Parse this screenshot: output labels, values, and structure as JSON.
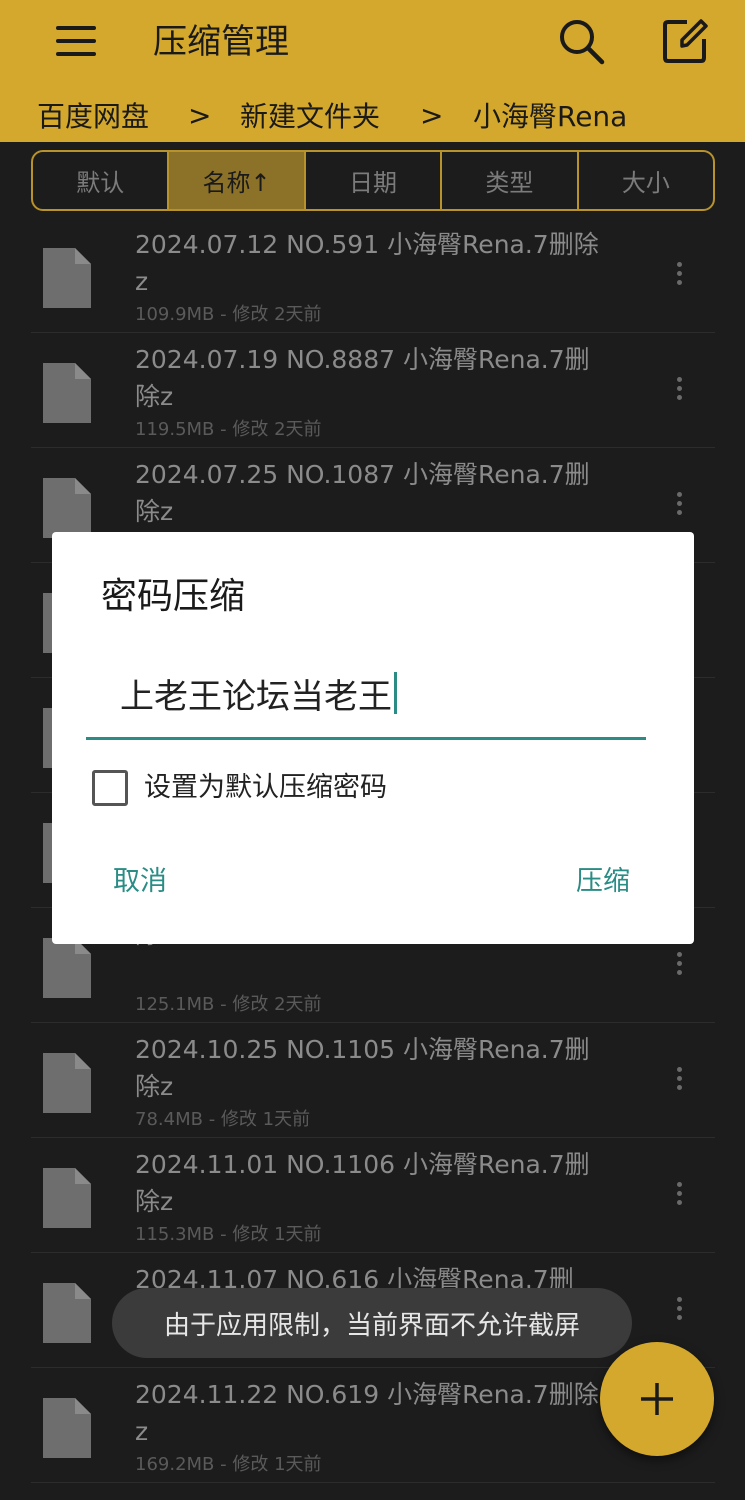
{
  "header": {
    "title": "压缩管理",
    "breadcrumb": [
      "百度网盘",
      "新建文件夹",
      "小海臀Rena"
    ],
    "separator": ">"
  },
  "sort_tabs": [
    "默认",
    "名称↑",
    "日期",
    "类型",
    "大小"
  ],
  "active_sort_tab": "名称↑",
  "files": [
    {
      "name": "2024.07.12 NO.591 小海臀Rena.7删除z",
      "size": "109.9MB",
      "modified": "修改 2天前"
    },
    {
      "name": "2024.07.19 NO.8887 小海臀Rena.7删除z",
      "size": "119.5MB",
      "modified": "修改 2天前"
    },
    {
      "name": "2024.07.25 NO.1087 小海臀Rena.7删除z",
      "size": "",
      "modified": ""
    },
    {
      "name": "",
      "size": "",
      "modified": ""
    },
    {
      "name": "",
      "size": "",
      "modified": ""
    },
    {
      "name": "",
      "size": "",
      "modified": ""
    },
    {
      "name": "除z",
      "size": "125.1MB",
      "modified": "修改 2天前"
    },
    {
      "name": "2024.10.25 NO.1105 小海臀Rena.7删除z",
      "size": "78.4MB",
      "modified": "修改 1天前"
    },
    {
      "name": "2024.11.01 NO.1106 小海臀Rena.7删除z",
      "size": "115.3MB",
      "modified": "修改 1天前"
    },
    {
      "name": "2024.11.07 NO.616 小海臀Rena.7删",
      "size": "",
      "modified": ""
    },
    {
      "name": "2024.11.22 NO.619 小海臀Rena.7删除z",
      "size": "169.2MB",
      "modified": "修改 1天前"
    }
  ],
  "meta_separator": " - ",
  "dialog": {
    "title": "密码压缩",
    "password_value": "上老王论坛当老王",
    "checkbox_label": "设置为默认压缩密码",
    "checkbox_checked": false,
    "cancel_label": "取消",
    "confirm_label": "压缩"
  },
  "toast": "由于应用限制，当前界面不允许截屏",
  "fab_label": "+",
  "colors": {
    "accent": "#d4a82c",
    "dialog_accent": "#2a8c84",
    "background": "#1c1c1c"
  }
}
